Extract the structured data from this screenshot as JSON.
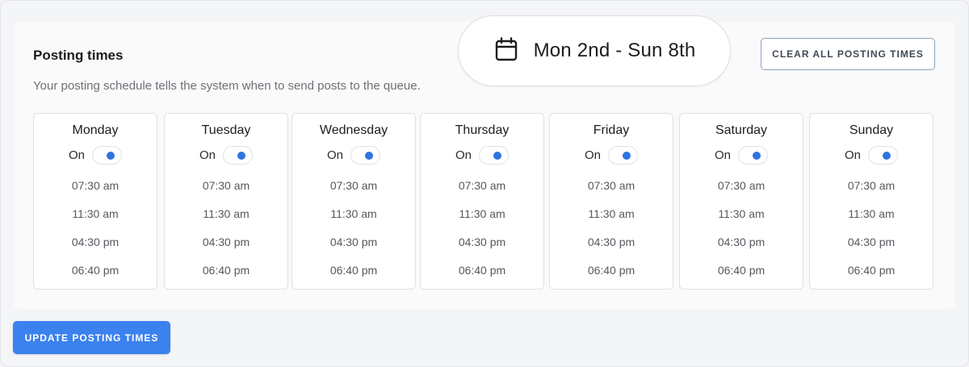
{
  "header": {
    "title": "Posting times",
    "subtitle": "Your posting schedule tells the system when to send posts to the queue.",
    "date_range": "Mon 2nd - Sun 8th",
    "clear_button": "CLEAR ALL POSTING TIMES"
  },
  "days": [
    {
      "name": "Monday",
      "status": "On",
      "enabled": true,
      "times": [
        "07:30 am",
        "11:30 am",
        "04:30 pm",
        "06:40 pm"
      ]
    },
    {
      "name": "Tuesday",
      "status": "On",
      "enabled": true,
      "times": [
        "07:30 am",
        "11:30 am",
        "04:30 pm",
        "06:40 pm"
      ]
    },
    {
      "name": "Wednesday",
      "status": "On",
      "enabled": true,
      "times": [
        "07:30 am",
        "11:30 am",
        "04:30 pm",
        "06:40 pm"
      ]
    },
    {
      "name": "Thursday",
      "status": "On",
      "enabled": true,
      "times": [
        "07:30 am",
        "11:30 am",
        "04:30 pm",
        "06:40 pm"
      ]
    },
    {
      "name": "Friday",
      "status": "On",
      "enabled": true,
      "times": [
        "07:30 am",
        "11:30 am",
        "04:30 pm",
        "06:40 pm"
      ]
    },
    {
      "name": "Saturday",
      "status": "On",
      "enabled": true,
      "times": [
        "07:30 am",
        "11:30 am",
        "04:30 pm",
        "06:40 pm"
      ]
    },
    {
      "name": "Sunday",
      "status": "On",
      "enabled": true,
      "times": [
        "07:30 am",
        "11:30 am",
        "04:30 pm",
        "06:40 pm"
      ]
    }
  ],
  "footer": {
    "update_button": "UPDATE POSTING TIMES"
  },
  "colors": {
    "accent": "#3b82ee",
    "toggle_on": "#2f74e0",
    "clear_button_border": "#8da3bd"
  },
  "icons": {
    "date_pill": "calendar-icon"
  }
}
